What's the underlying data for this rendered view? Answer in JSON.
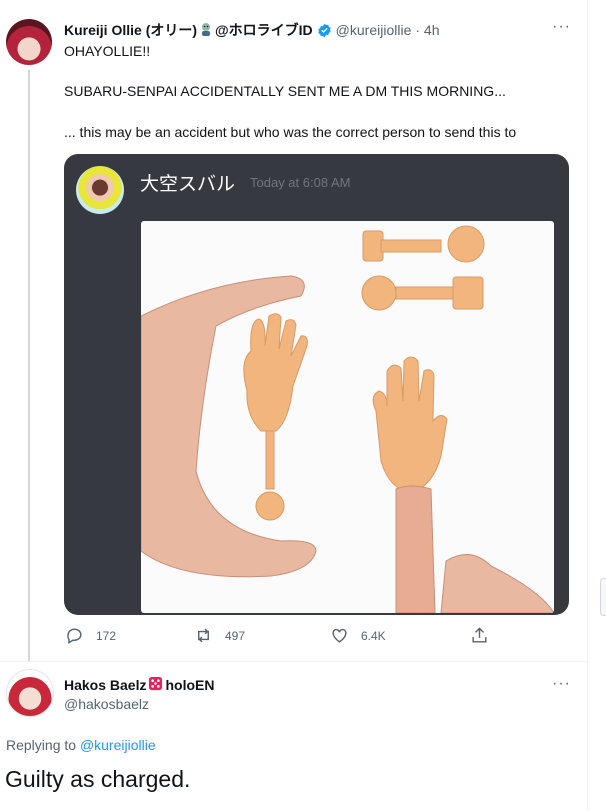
{
  "tweet": {
    "author_name": "Kureiji Ollie (オリー)",
    "author_suffix": "@ホロライブID",
    "author_handle": "@kureijiollie",
    "time": "· 4h",
    "lines": [
      "OHAYOLLIE!!",
      "SUBARU-SENPAI ACCIDENTALLY SENT ME A DM THIS MORNING...",
      "... this may be an accident but who was the correct person to send this to"
    ],
    "more_label": "···",
    "embed": {
      "username": "大空スバル",
      "timestamp": "Today at 6:08 AM",
      "image": "small-finger-hands-photo"
    },
    "actions": {
      "replies": "172",
      "retweets": "497",
      "likes": "6.4K"
    }
  },
  "reply": {
    "author_name": "Hakos Baelz",
    "author_suffix": "holoEN",
    "author_handle": "@hakosbaelz",
    "more_label": "···",
    "replying_prefix": "Replying to",
    "replying_handle": "@kureijiollie",
    "text": "Guilty as charged."
  },
  "colors": {
    "accent": "#1d9bf0",
    "text": "#0f1419",
    "muted": "#536471",
    "discord_bg": "#36393f"
  },
  "icons": [
    "verified-badge-icon",
    "reply-icon",
    "retweet-icon",
    "like-icon",
    "share-icon",
    "more-icon",
    "dice-icon"
  ]
}
